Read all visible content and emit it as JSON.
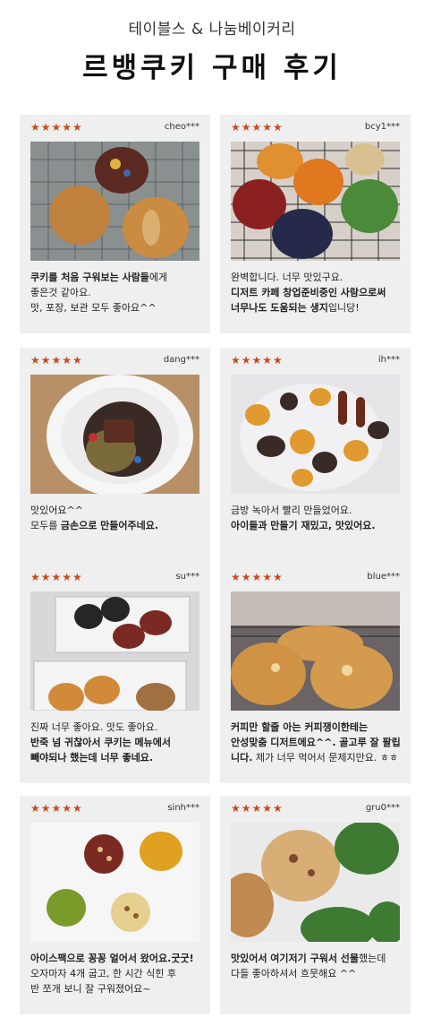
{
  "header": {
    "brand": "테이블스 & 나눔베이커리",
    "title": "르뱅쿠키 구매 후기"
  },
  "stars": "★★★★★",
  "reviews": [
    {
      "user": "cheo***",
      "lines": [
        [
          {
            "t": "쿠키를 처음 구워보는 사람들",
            "b": true
          },
          {
            "t": "에게",
            "b": false
          }
        ],
        [
          {
            "t": "좋은것 같아요.",
            "b": false
          }
        ],
        [
          {
            "t": "맛, 포장, 보관 모두 좋아요^^",
            "b": false
          }
        ]
      ]
    },
    {
      "user": "bcy1***",
      "lines": [
        [
          {
            "t": "완벽합니다. 너무 맛있구요.",
            "b": false
          }
        ],
        [
          {
            "t": "디저트 카페 창업준비중인 사람으로써",
            "b": true
          }
        ],
        [
          {
            "t": "너무나도 도움되는 생지",
            "b": true
          },
          {
            "t": "입니당!",
            "b": false
          }
        ]
      ]
    },
    {
      "user": "dang***",
      "lines": [
        [
          {
            "t": "맛있어요^^",
            "b": false
          }
        ],
        [
          {
            "t": "모두를 ",
            "b": false
          },
          {
            "t": "금손으로 만들어주네요.",
            "b": true
          }
        ]
      ]
    },
    {
      "user": "ih***",
      "lines": [
        [
          {
            "t": "금방 녹아서 빨리 만들었어요.",
            "b": false
          }
        ],
        [
          {
            "t": "아이들과 만들기 재밌고, 맛있어요.",
            "b": true
          }
        ]
      ]
    },
    {
      "user": "su***",
      "lines": [
        [
          {
            "t": "진짜 너무 좋아요. 맛도 좋아요.",
            "b": false
          }
        ],
        [
          {
            "t": "반죽 넘 귀찮아서 쿠키는 메뉴에서",
            "b": true
          }
        ],
        [
          {
            "t": "빼야되나 했는데 너무 좋네요.",
            "b": true
          }
        ]
      ]
    },
    {
      "user": "blue***",
      "lines": [
        [
          {
            "t": "커피만 할줄 아는 커피쟁이한테는",
            "b": true
          }
        ],
        [
          {
            "t": "안성맞춤 디저트에요^^. 골고루 잘 팔립",
            "b": true
          }
        ],
        [
          {
            "t": "니다.",
            "b": true
          },
          {
            "t": " 제가 너무 먹어서 문제지만요. ㅎㅎ",
            "b": false
          }
        ]
      ]
    },
    {
      "user": "sinh***",
      "lines": [
        [
          {
            "t": "아이스팩으로 꽁꽁 얼어서 왔어요.굿굿!",
            "b": true
          }
        ],
        [
          {
            "t": "오자마자 4개 굽고, 한 시간 식힌 후",
            "b": false
          }
        ],
        [
          {
            "t": "반 쪼개 보니 잘 구워졌어요~",
            "b": false
          }
        ]
      ]
    },
    {
      "user": "gru0***",
      "lines": [
        [
          {
            "t": "맛있어서 여기저기 구워서 선물",
            "b": true
          },
          {
            "t": "했는데",
            "b": false
          }
        ],
        [
          {
            "t": "다들 좋아하셔서 흐뭇해요 ^^",
            "b": false
          }
        ]
      ]
    }
  ]
}
